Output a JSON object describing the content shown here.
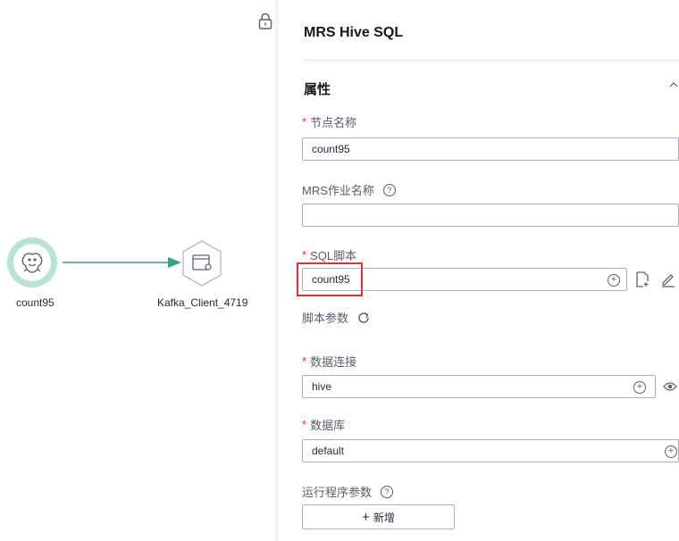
{
  "canvas": {
    "source_node_label": "count95",
    "target_node_label": "Kafka_Client_4719"
  },
  "panel": {
    "title": "MRS Hive SQL",
    "section_title": "属性",
    "fields": {
      "node_name": {
        "label": "节点名称",
        "value": "count95"
      },
      "mrs_job_name": {
        "label": "MRS作业名称",
        "value": ""
      },
      "sql_script": {
        "label": "SQL脚本",
        "value": "count95"
      },
      "script_params": {
        "label": "脚本参数"
      },
      "data_connection": {
        "label": "数据连接",
        "value": "hive"
      },
      "database": {
        "label": "数据库",
        "value": "default"
      },
      "runtime_params": {
        "label": "运行程序参数"
      }
    },
    "add_button": {
      "icon": "+",
      "label": "新增"
    }
  },
  "colors": {
    "accent_green": "#33a08a",
    "highlight_red": "#e3312f"
  }
}
